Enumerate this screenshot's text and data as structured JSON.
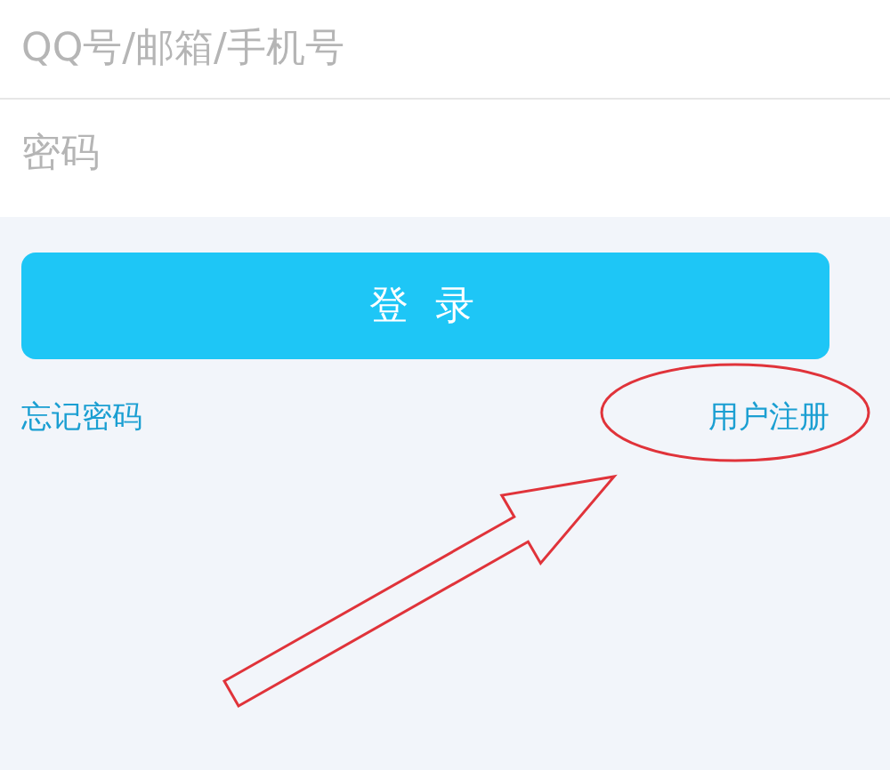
{
  "fields": [
    {
      "placeholder": "QQ号/邮箱/手机号"
    },
    {
      "placeholder": "密码"
    }
  ],
  "login_button": "登 录",
  "links": {
    "forgot": "忘记密码",
    "register": "用户注册"
  }
}
